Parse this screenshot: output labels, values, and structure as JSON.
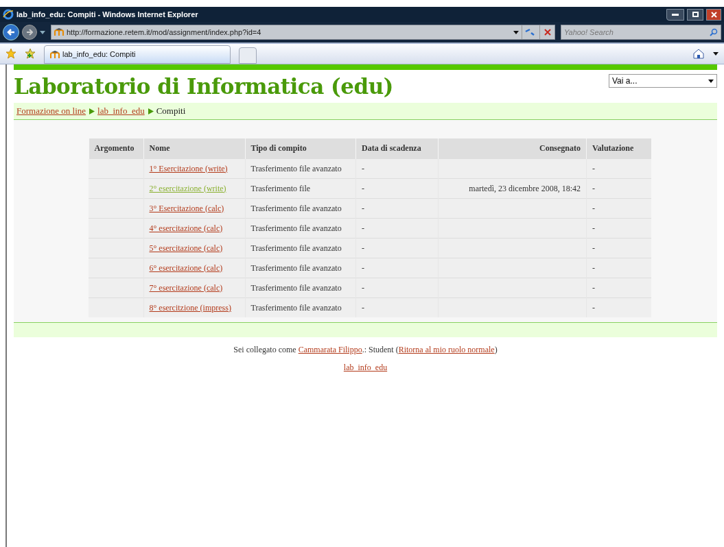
{
  "window": {
    "title": "lab_info_edu: Compiti - Windows Internet Explorer"
  },
  "address_bar": {
    "url": "http://formazione.retem.it/mod/assignment/index.php?id=4"
  },
  "search": {
    "placeholder": "Yahoo! Search"
  },
  "tabs": [
    {
      "label": "lab_info_edu: Compiti",
      "selected": true
    }
  ],
  "page": {
    "heading": "Laboratorio di Informatica (edu)",
    "jump_menu": "Vai a...",
    "breadcrumb": [
      {
        "label": "Formazione on line",
        "link": true
      },
      {
        "label": "lab_info_edu",
        "link": true
      },
      {
        "label": "Compiti",
        "link": false
      }
    ],
    "table": {
      "columns": [
        "Argomento",
        "Nome",
        "Tipo di compito",
        "Data di scadenza",
        "Consegnato",
        "Valutazione"
      ],
      "rows": [
        {
          "argomento": "",
          "name": "1° Esercitazione (write)",
          "visited": false,
          "type": "Trasferimento file avanzato",
          "due": "-",
          "submitted": "",
          "grade": "-"
        },
        {
          "argomento": "",
          "name": "2° esercitazione (write)",
          "visited": true,
          "type": "Trasferimento file",
          "due": "-",
          "submitted": "martedì, 23 dicembre 2008, 18:42",
          "grade": "-"
        },
        {
          "argomento": "",
          "name": "3° Esercitazione (calc)",
          "visited": false,
          "type": "Trasferimento file avanzato",
          "due": "-",
          "submitted": "",
          "grade": "-"
        },
        {
          "argomento": "",
          "name": "4° esercitazione (calc)",
          "visited": false,
          "type": "Trasferimento file avanzato",
          "due": "-",
          "submitted": "",
          "grade": "-"
        },
        {
          "argomento": "",
          "name": "5° esercitazione (calc)",
          "visited": false,
          "type": "Trasferimento file avanzato",
          "due": "-",
          "submitted": "",
          "grade": "-"
        },
        {
          "argomento": "",
          "name": "6° esercitazione (calc)",
          "visited": false,
          "type": "Trasferimento file avanzato",
          "due": "-",
          "submitted": "",
          "grade": "-"
        },
        {
          "argomento": "",
          "name": "7° esercitazione (calc)",
          "visited": false,
          "type": "Trasferimento file avanzato",
          "due": "-",
          "submitted": "",
          "grade": "-"
        },
        {
          "argomento": "",
          "name": "8° esercitzione (impress)",
          "visited": false,
          "type": "Trasferimento file avanzato",
          "due": "-",
          "submitted": "",
          "grade": "-"
        }
      ]
    },
    "footer": {
      "login_prefix": "Sei collegato come ",
      "user_link": "Cammarata Filippo",
      "login_middle": ".: Student (",
      "role_link": "Ritorna al mio ruolo normale",
      "login_suffix": ")",
      "course_link": "lab_info_edu"
    }
  }
}
